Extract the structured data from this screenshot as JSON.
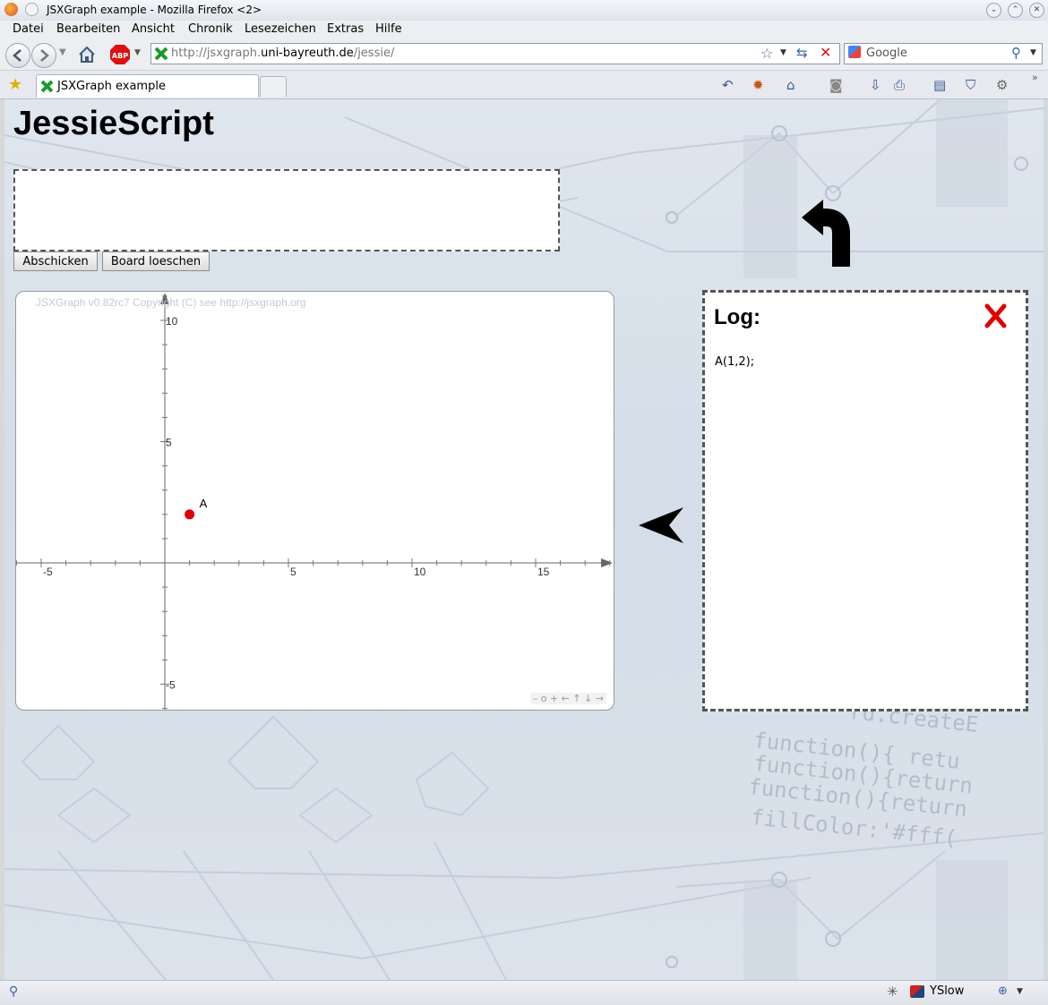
{
  "window": {
    "title": "JSXGraph example - Mozilla Firefox <2>"
  },
  "menu": [
    "Datei",
    "Bearbeiten",
    "Ansicht",
    "Chronik",
    "Lesezeichen",
    "Extras",
    "Hilfe"
  ],
  "navigation": {
    "url_prefix": "http://jsxgraph.",
    "url_domain": "uni-bayreuth.de",
    "url_path": "/jessie/",
    "search_placeholder": "Google"
  },
  "tabs": [
    {
      "label": "JSXGraph example",
      "active": true
    }
  ],
  "page": {
    "title": "JessieScript",
    "input_value": "",
    "submit_label": "Abschicken",
    "clear_label": "Board loeschen"
  },
  "board": {
    "copyright": "JSXGraph v0.82rc7 Copyright (C) see http://jsxgraph.org",
    "navigation_controls": "– o + ← ↑ ↓ →"
  },
  "chart_data": {
    "type": "scatter",
    "x_ticks": [
      -5,
      5,
      10,
      15
    ],
    "y_ticks": [
      10,
      5,
      -5
    ],
    "xlim": [
      -6,
      18
    ],
    "ylim": [
      -6,
      11
    ],
    "point_color": "#e00000",
    "points": [
      {
        "name": "A",
        "x": 1,
        "y": 2
      }
    ]
  },
  "log": {
    "heading": "Log:",
    "entries": [
      "A(1,2);"
    ]
  },
  "background_text": [
    "rd.createE",
    "function(){ retu",
    "function(){return",
    "function(){return",
    "fillColor:'#fff("
  ],
  "statusbar": {
    "yslow_label": "YSlow"
  },
  "colors": {
    "accent_red": "#e00000",
    "page_background": "#dbe2eb"
  }
}
